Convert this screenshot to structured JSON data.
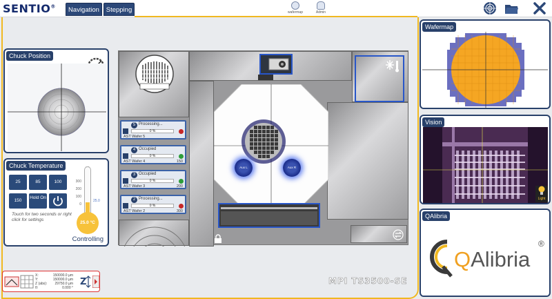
{
  "app": {
    "logo": "SENTIO",
    "logo_mark": "®",
    "model": "MPI TS3500-SE"
  },
  "tabs": [
    {
      "label": "Navigation"
    },
    {
      "label": "Stepping"
    }
  ],
  "top_icons": [
    {
      "label": "wafermap"
    },
    {
      "label": "Admin"
    }
  ],
  "toolbar_icons": [
    "target-icon",
    "folder-icon",
    "close-icon"
  ],
  "chuck_position": {
    "title": "Chuck Position"
  },
  "chuck_temperature": {
    "title": "Chuck Temperature",
    "buttons": [
      "25",
      "85",
      "100",
      "150",
      "Hold On"
    ],
    "hint": "Touch for two seconds or right click for settings",
    "unit": "°C",
    "scale": [
      "300",
      "200",
      "100",
      "0"
    ],
    "value": "25.0 °C",
    "marker": "25.0",
    "status": "Controlling"
  },
  "wafer_slots": [
    {
      "number": "5",
      "status": "Processing...",
      "percent": "0 %",
      "name": "AST Wafer 5",
      "value": "",
      "led": "#c62828"
    },
    {
      "number": "4",
      "status": "Occupied",
      "percent": "0 %",
      "name": "AST Wafer 4",
      "value": "150",
      "led": "#2e9d3a"
    },
    {
      "number": "3",
      "status": "Occupied",
      "percent": "0 %",
      "name": "AST Wafer 3",
      "value": "200",
      "led": "#2e9d3a"
    },
    {
      "number": "2",
      "status": "Processing...",
      "percent": "0 %",
      "name": "AST Wafer 2",
      "value": "300",
      "led": "#c62828"
    }
  ],
  "station": {
    "aux_left": "Aux L",
    "aux_right": "Aux R",
    "wafer_id": "1"
  },
  "position": {
    "labels": [
      "X:",
      "Y:",
      "Z (abs):",
      "θ:"
    ],
    "values": [
      "150000.0 µm",
      "150000.0 µm",
      "29750.0 µm",
      "0.000 °"
    ]
  },
  "wafermap": {
    "title": "Wafermap"
  },
  "vision": {
    "title": "Vision",
    "light_label": "Light"
  },
  "qalibria": {
    "title": "QAlibria",
    "brand_q": "Q",
    "brand_rest": "Alibria",
    "mark": "®"
  },
  "colors": {
    "navy": "#28406a",
    "accent": "#f0b820",
    "wafer": "#f5a623"
  }
}
